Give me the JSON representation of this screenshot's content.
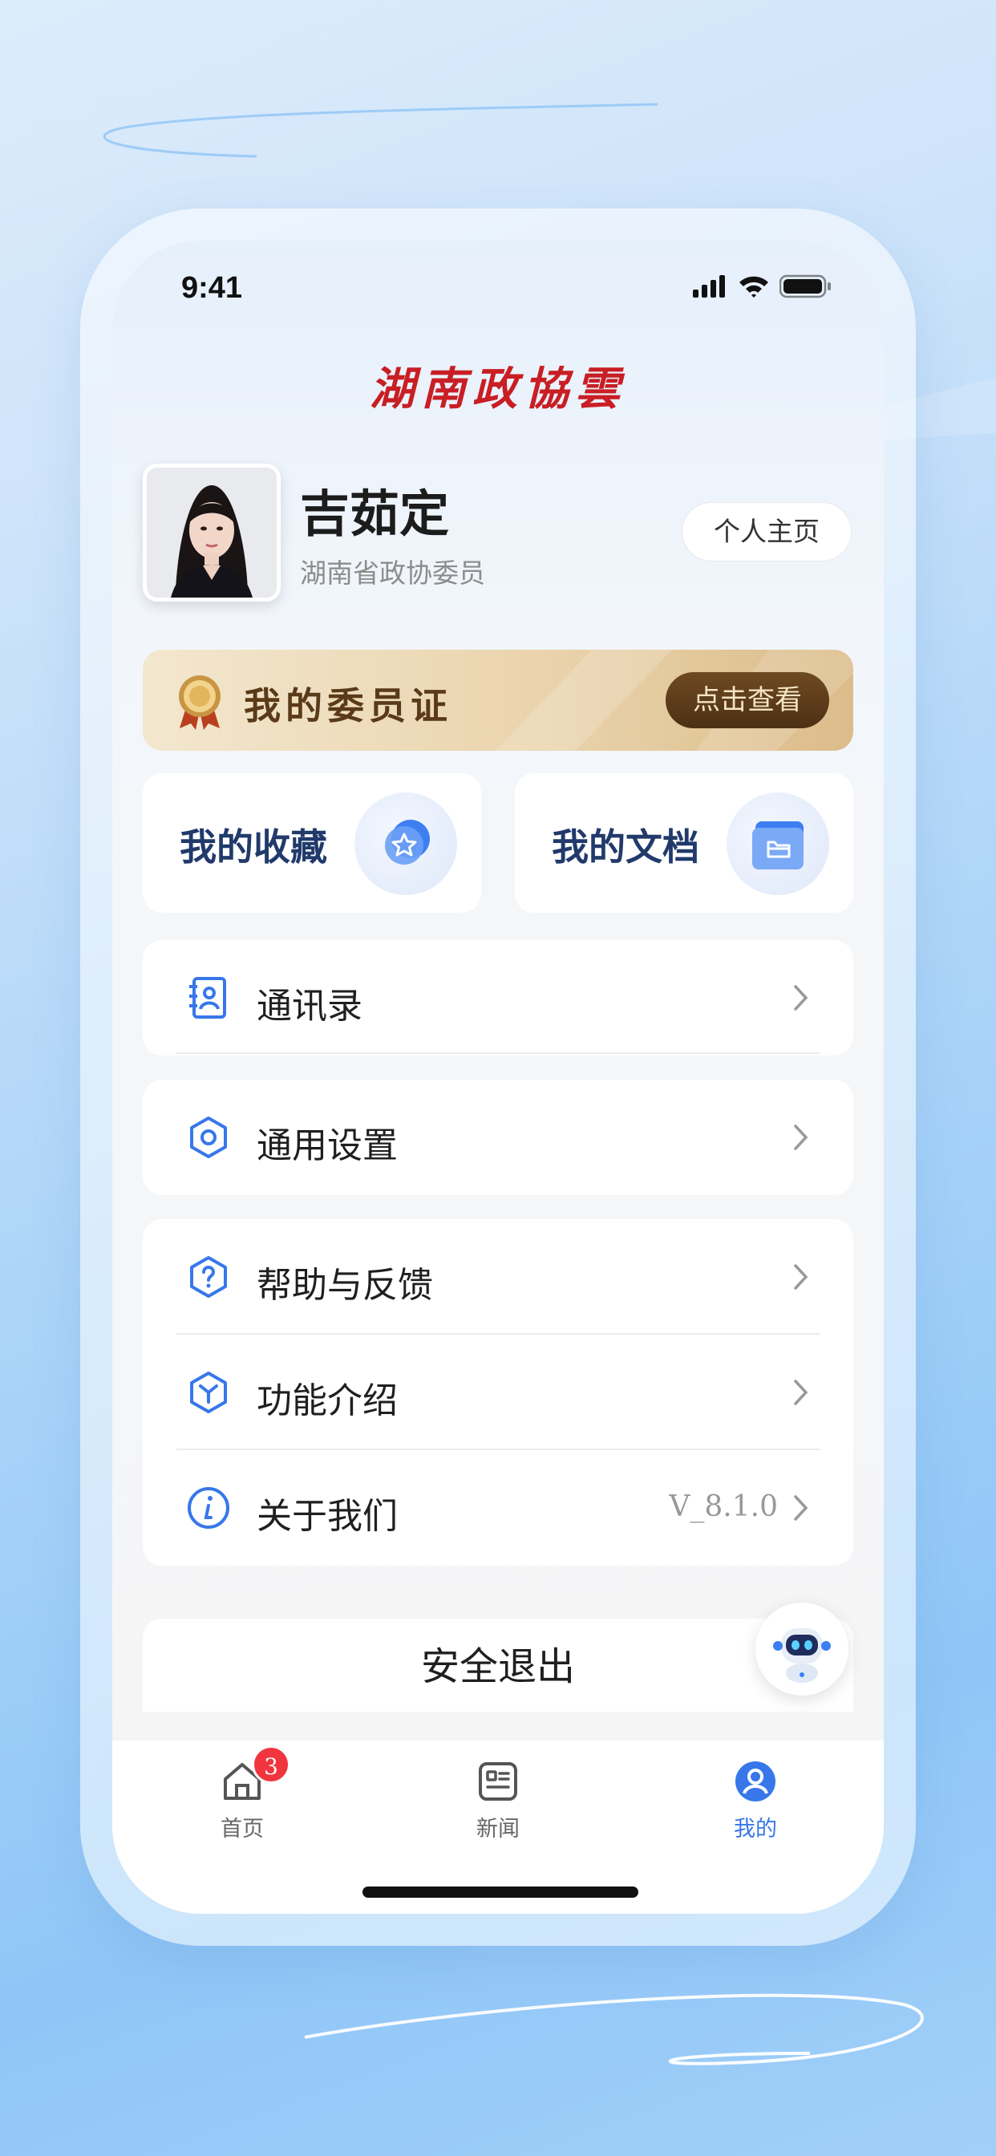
{
  "status_bar": {
    "time": "9:41"
  },
  "brand": {
    "name": "湖南政協雲"
  },
  "profile": {
    "name": "吉茹定",
    "role": "湖南省政协委员",
    "profile_button": "个人主页"
  },
  "member_card": {
    "title": "我的委员证",
    "button": "点击查看"
  },
  "quick_actions": [
    {
      "label": "我的收藏",
      "icon": "star-icon"
    },
    {
      "label": "我的文档",
      "icon": "folder-icon"
    }
  ],
  "menu": {
    "contacts": {
      "label": "通讯录",
      "icon": "contacts-icon"
    },
    "settings": {
      "label": "通用设置",
      "icon": "settings-icon"
    },
    "help": {
      "label": "帮助与反馈",
      "icon": "help-icon"
    },
    "features": {
      "label": "功能介绍",
      "icon": "feature-icon"
    },
    "about": {
      "label": "关于我们",
      "icon": "info-icon",
      "version": "V_8.1.0"
    }
  },
  "logout": {
    "label": "安全退出"
  },
  "tabs": [
    {
      "label": "首页",
      "icon": "home-icon",
      "badge": "3",
      "active": false
    },
    {
      "label": "新闻",
      "icon": "news-icon",
      "active": false
    },
    {
      "label": "我的",
      "icon": "user-icon",
      "active": true
    }
  ],
  "colors": {
    "accent": "#3777ea",
    "brand_red": "#c81e24",
    "badge": "#f0353e",
    "card_gold": "#ead4ad"
  }
}
